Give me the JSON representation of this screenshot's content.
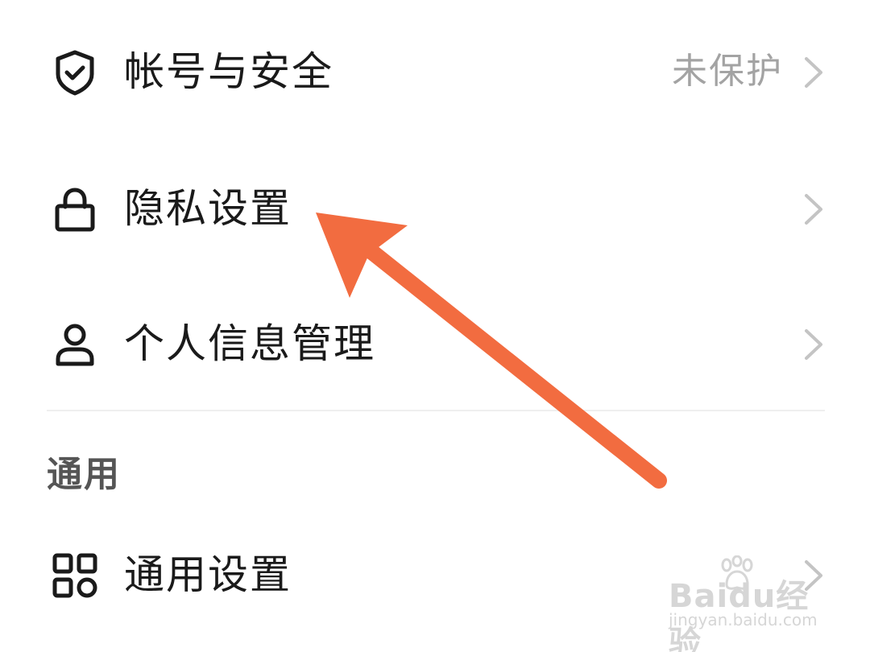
{
  "settings": {
    "items": [
      {
        "label": "帐号与安全",
        "status": "未保护",
        "icon": "shield-check-icon"
      },
      {
        "label": "隐私设置",
        "status": "",
        "icon": "lock-icon"
      },
      {
        "label": "个人信息管理",
        "status": "",
        "icon": "person-icon"
      }
    ],
    "section_title": "通用",
    "general_items": [
      {
        "label": "通用设置",
        "icon": "grid-icon"
      }
    ]
  },
  "annotation": {
    "arrow_color": "#f26c40",
    "target": "隐私设置"
  },
  "watermark": {
    "brand": "Baidu经验",
    "url": "jingyan.baidu.com"
  },
  "colors": {
    "text": "#1a1a1a",
    "secondary": "#a3a3a3",
    "chevron": "#c4c4c4",
    "section": "#555555",
    "divider": "#efefef"
  }
}
